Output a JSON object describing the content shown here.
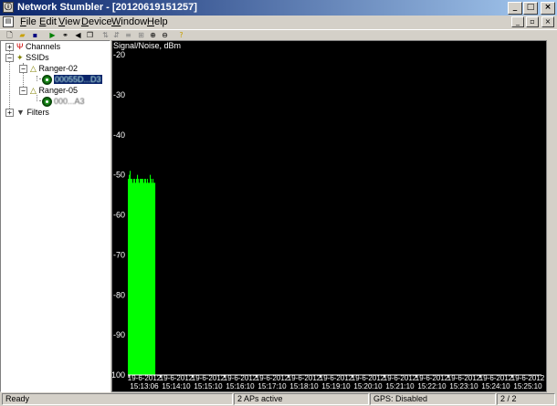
{
  "window": {
    "title": "Network Stumbler - [20120619151257]"
  },
  "menu": [
    {
      "label": "File",
      "key": "F",
      "rest": "ile"
    },
    {
      "label": "Edit",
      "key": "E",
      "rest": "dit"
    },
    {
      "label": "View",
      "key": "V",
      "rest": "iew"
    },
    {
      "label": "Device",
      "key": "D",
      "rest": "evice"
    },
    {
      "label": "Window",
      "key": "W",
      "rest": "indow"
    },
    {
      "label": "Help",
      "key": "H",
      "rest": "elp"
    }
  ],
  "toolbar_icons": [
    "new-icon",
    "open-icon",
    "save-icon",
    "play-icon",
    "scan-icon",
    "speaker-icon",
    "window-icon",
    "sort-icon",
    "sort-desc-icon",
    "list-icon",
    "grid-icon",
    "zoom-in-icon",
    "zoom-out-icon",
    "help-icon"
  ],
  "tree": {
    "channels": "Channels",
    "ssids": "SSIDs",
    "ssid1": "Ranger-02",
    "ap1": "00055D...D3",
    "ssid2": "Ranger-05",
    "ap2": "000...A3",
    "filters": "Filters"
  },
  "chart_data": {
    "type": "bar",
    "title": "Signal/Noise, dBm",
    "ylim": [
      -100,
      -20
    ],
    "yticks": [
      -20,
      -30,
      -40,
      -50,
      -60,
      -70,
      -80,
      -90,
      -100
    ],
    "xtick_dates": [
      "19-6-2012",
      "19-6-2012",
      "19-6-2012",
      "19-6-2012",
      "19-6-2012",
      "19-6-2012",
      "19-6-2012",
      "19-6-2012",
      "19-6-2012",
      "19-6-2012",
      "19-6-2012",
      "19-6-2012",
      "19-6-2012"
    ],
    "xtick_times": [
      "15:13:06",
      "15:14:10",
      "15:15:10",
      "15:16:10",
      "15:17:10",
      "15:18:10",
      "15:19:10",
      "15:20:10",
      "15:21:10",
      "15:22:10",
      "15:23:10",
      "15:24:10",
      "15:25:10"
    ],
    "series": [
      {
        "values": [
          -51,
          -50,
          -49,
          -51,
          -51,
          -52,
          -51,
          -51,
          -52,
          -51,
          -50,
          -51,
          -52,
          -51,
          -51,
          -51,
          -51,
          -52,
          -51,
          -51,
          -52,
          -51,
          -52,
          -52,
          -50,
          -51,
          -52,
          -51,
          -52,
          -52
        ]
      }
    ],
    "bar_color": "#00ff00"
  },
  "status": {
    "ready": "Ready",
    "aps": "2 APs active",
    "gps": "GPS: Disabled",
    "count": "2 / 2"
  }
}
